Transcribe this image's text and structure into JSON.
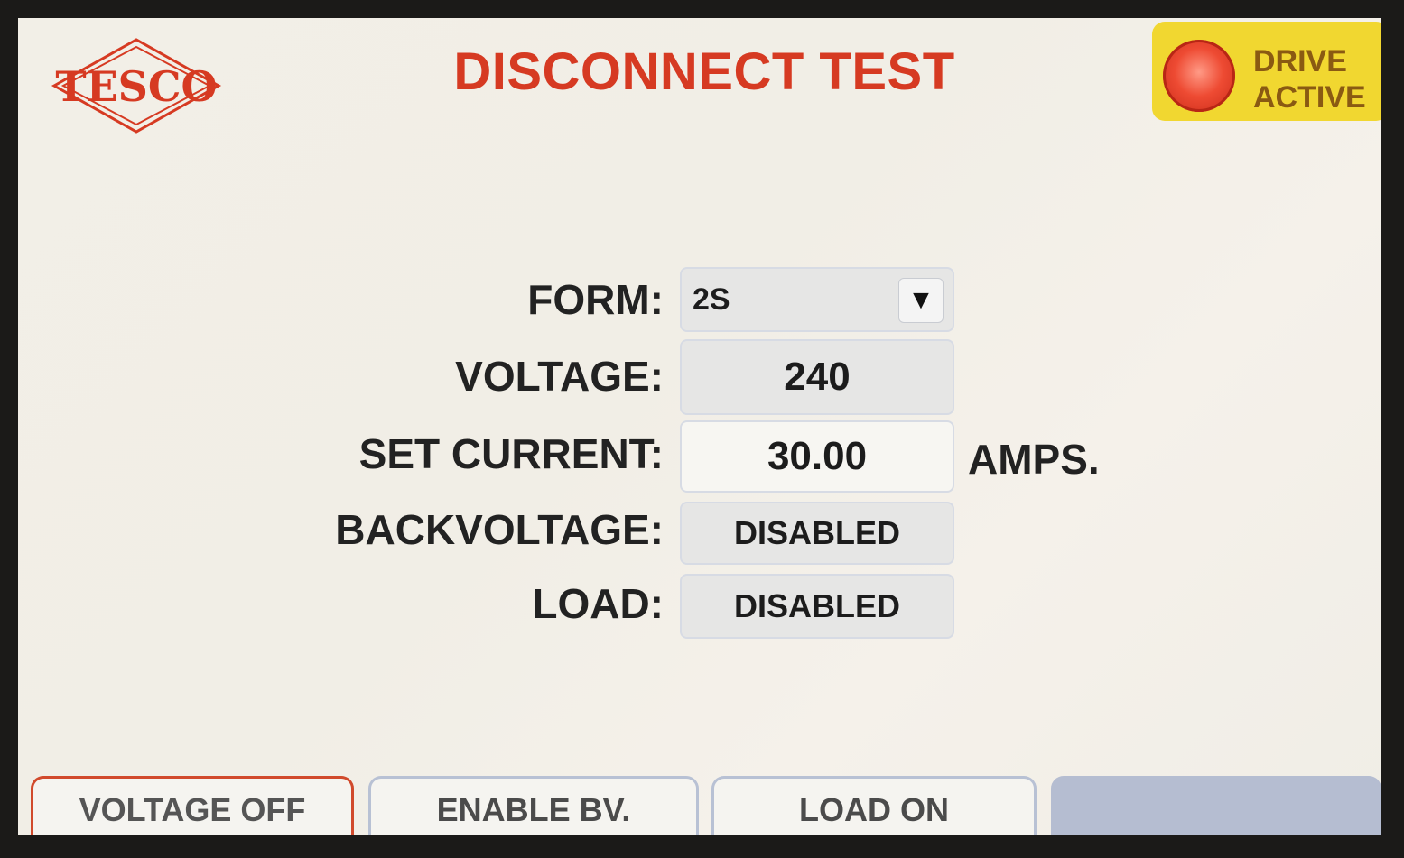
{
  "brand": {
    "logo_text": "TESCO",
    "color": "#d63a22"
  },
  "header": {
    "title": "DISCONNECT TEST"
  },
  "status": {
    "line1": "DRIVE",
    "line2": "ACTIVE",
    "indicator_color": "#ee4b33",
    "background": "#f1d730"
  },
  "form": {
    "form_label": "FORM:",
    "form_value": "2S",
    "voltage_label": "VOLTAGE:",
    "voltage_value": "240",
    "current_label": "SET CURRENT:",
    "current_value": "30.00",
    "current_units": "AMPS.",
    "backvoltage_label": "BACKVOLTAGE:",
    "backvoltage_value": "DISABLED",
    "load_label": "LOAD:",
    "load_value": "DISABLED"
  },
  "icons": {
    "dropdown": "chevron-down-icon",
    "indicator": "status-light-icon"
  },
  "buttons": {
    "voltage_off": "VOLTAGE OFF",
    "enable_bv": "ENABLE BV.",
    "load_on": "LOAD ON"
  }
}
